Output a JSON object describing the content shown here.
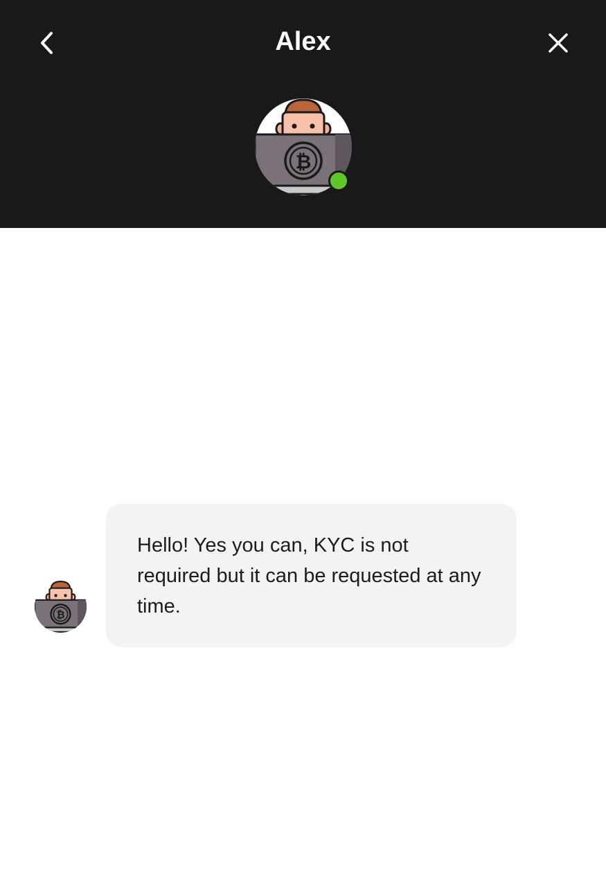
{
  "header": {
    "title": "Alex",
    "back_icon": "chevron-left-icon",
    "close_icon": "close-icon",
    "background_color": "#191919",
    "status": "online",
    "status_color": "#5ec72c"
  },
  "conversation": {
    "messages": [
      {
        "sender": "Alex",
        "text": "Hello! Yes you can, KYC is not required but it can be requested at any time.",
        "bubble_color": "#f3f3f3"
      }
    ]
  }
}
